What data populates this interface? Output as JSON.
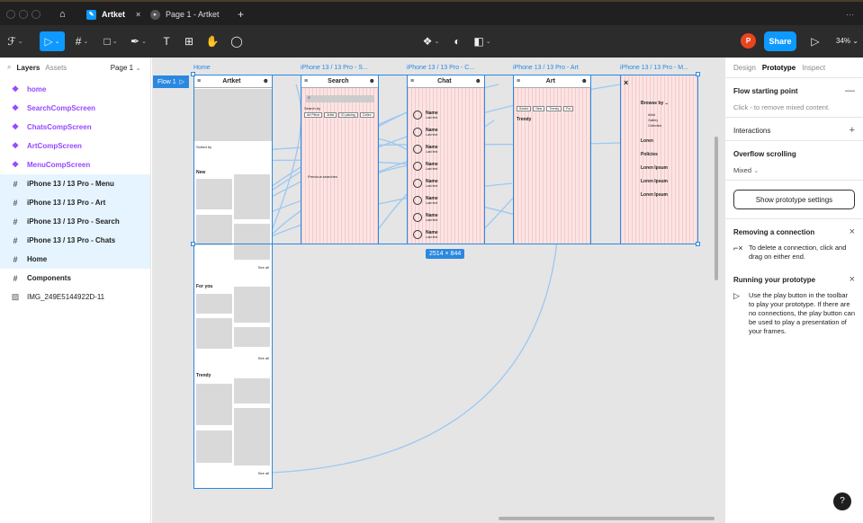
{
  "titlebar": {
    "tabs": [
      {
        "label": "Artket"
      },
      {
        "label": "Page 1 - Artket"
      }
    ],
    "new_tab": "+",
    "more": "···"
  },
  "toolbar": {
    "share_label": "Share",
    "avatar_initial": "P",
    "zoom": "34%"
  },
  "left_panel": {
    "tabs": {
      "layers": "Layers",
      "assets": "Assets",
      "page": "Page 1"
    },
    "layers": [
      {
        "label": "home",
        "kind": "component"
      },
      {
        "label": "SearchCompScreen",
        "kind": "component"
      },
      {
        "label": "ChatsCompScreen",
        "kind": "component"
      },
      {
        "label": "ArtCompScreen",
        "kind": "component"
      },
      {
        "label": "MenuCompScreen",
        "kind": "component"
      },
      {
        "label": "iPhone 13 / 13 Pro - Menu",
        "kind": "frame"
      },
      {
        "label": "iPhone 13 / 13 Pro - Art",
        "kind": "frame"
      },
      {
        "label": "iPhone 13 / 13 Pro - Search",
        "kind": "frame"
      },
      {
        "label": "iPhone 13 / 13 Pro - Chats",
        "kind": "frame"
      },
      {
        "label": "Home",
        "kind": "frame"
      },
      {
        "label": "Components",
        "kind": "plain"
      },
      {
        "label": "IMG_249E5144922D-11",
        "kind": "image"
      }
    ]
  },
  "canvas": {
    "flow_label": "Flow 1",
    "size_badge": "2514 × 844",
    "frames": {
      "home": {
        "label": "Home",
        "title": "Artket",
        "sorted_by": "Sorted by",
        "new": "New",
        "for_you": "For you",
        "trendy": "Trendy",
        "see_all": "See all"
      },
      "search": {
        "label": "iPhone 13 / 13 Pro - S...",
        "title": "Search",
        "search_by": "Search by",
        "chips": [
          "Art Piece",
          "Artist",
          "ID placing",
          "Collec"
        ],
        "previous": "Previous searches"
      },
      "chat": {
        "label": "iPhone 13 / 13 Pro - C...",
        "title": "Chat",
        "name": "Name",
        "last_text": "Last text"
      },
      "art": {
        "label": "iPhone 13 / 13 Pro - Art",
        "title": "Art",
        "filters": [
          "Sorted",
          "New",
          "Trendy",
          "For"
        ],
        "trendy": "Trendy"
      },
      "menu": {
        "label": "iPhone 13 / 13 Pro - M...",
        "browse_by": "Browse by",
        "sub": [
          "Artist",
          "Gallery",
          "Collection"
        ],
        "items": [
          "Loren",
          "Policies",
          "Loren Ipsum",
          "Loren Ipsum",
          "Loren Ipsum"
        ]
      }
    }
  },
  "right_panel": {
    "tabs": {
      "design": "Design",
      "prototype": "Prototype",
      "inspect": "Inspect"
    },
    "flow_start": {
      "title": "Flow starting point",
      "hint": "Click - to remove mixed content."
    },
    "interactions": {
      "title": "Interactions"
    },
    "overflow": {
      "title": "Overflow scrolling",
      "value": "Mixed"
    },
    "settings_button": "Show prototype settings",
    "removing": {
      "title": "Removing a connection",
      "text": "To delete a connection, click and drag on either end."
    },
    "running": {
      "title": "Running your prototype",
      "text": "Use the play button in the toolbar to play your prototype. If there are no connections, the play button can be used to play a presentation of your frames."
    },
    "help": "?"
  },
  "colors": {
    "accent": "#0d99ff",
    "component": "#9747ff",
    "frame_outline": "#2b88e0",
    "avatar": "#e8451e"
  }
}
